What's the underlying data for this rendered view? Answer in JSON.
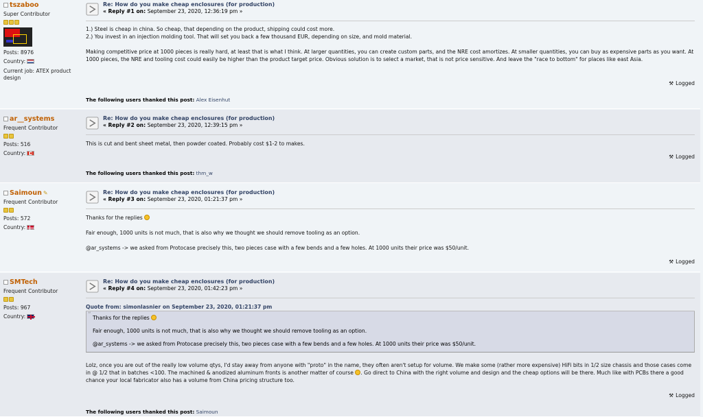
{
  "posts": [
    {
      "username": "tszaboo",
      "rank": "Super Contributor",
      "posts_label": "Posts: 8976",
      "country_label": "Country:",
      "job": "Current job: ATEX product design",
      "title": "Re: How do you make cheap enclosures (for production)",
      "reply_label": "« Reply #1 on:",
      "date": "September 23, 2020, 12:36:19 pm »",
      "body": [
        "1.) Steel is cheap in china. So cheap, that depending on the product, shipping could cost more.",
        "2.) You invest in an injection molding tool. That will set you back a few thousand EUR, depending on size, and mold material.",
        "Making competitive price at 1000 pieces is really hard, at least that is what I think. At larger quantities, you can create custom parts, and the NRE cost amortizes. At smaller quantities, you can buy as expensive parts as you want. At 1000 pieces, the NRE and tooling cost could easily be higher than the product target price. Obvious solution is to select a market, that is not price sensitive. And leave the \"race to bottom\" for places like east Asia."
      ],
      "logged": "Logged",
      "thanks_label": "The following users thanked this post:",
      "thanks_user": "Alex Eisenhut"
    },
    {
      "username": "ar__systems",
      "rank": "Frequent Contributor",
      "posts_label": "Posts: 516",
      "country_label": "Country:",
      "title": "Re: How do you make cheap enclosures (for production)",
      "reply_label": "« Reply #2 on:",
      "date": "September 23, 2020, 12:39:15 pm »",
      "body": [
        "This is cut and bent sheet metal, then powder coated. Probably cost $1-2 to makes."
      ],
      "logged": "Logged",
      "thanks_label": "The following users thanked this post:",
      "thanks_user": "thm_w"
    },
    {
      "username": "Saimoun",
      "rank": "Frequent Contributor",
      "posts_label": "Posts: 572",
      "country_label": "Country:",
      "title": "Re: How do you make cheap enclosures (for production)",
      "reply_label": "« Reply #3 on:",
      "date": "September 23, 2020, 01:21:37 pm »",
      "body": [
        "Thanks for the replies",
        "Fair enough, 1000 units is not much, that is also why we thought we should remove tooling as an option.",
        "@ar_systems -> we asked from Protocase precisely this, two pieces case with a few bends and a few holes. At 1000 units their price was $50/unit."
      ],
      "logged": "Logged"
    },
    {
      "username": "SMTech",
      "rank": "Frequent Contributor",
      "posts_label": "Posts: 967",
      "country_label": "Country:",
      "title": "Re: How do you make cheap enclosures (for production)",
      "reply_label": "« Reply #4 on:",
      "date": "September 23, 2020, 01:42:23 pm »",
      "quote_header": "Quote from: simonlasnier on September 23, 2020, 01:21:37 pm",
      "quote": [
        "Thanks for the replies",
        "Fair enough, 1000 units is not much, that is also why we thought we should remove tooling as an option.",
        "@ar_systems -> we asked from Protocase precisely this, two pieces case with a few bends and a few holes. At 1000 units their price was $50/unit."
      ],
      "body_a": "Lolz, once you are out of the really low volume qtys, I'd stay away from anyone with \"proto\" in the name, they often aren't setup for volume. We make some (rather more expensive) HiFi bits in 1/2 size chassis and those cases come in @ 1/2 that in batches <100. The machined & anodized aluminum fronts is another matter of course",
      "body_b": ". Go direct to China with the right volume and design and the cheap options will be there. Much like with PCBs there a good chance your local fabricator also has a volume from China pricing structure too.",
      "logged": "Logged",
      "thanks_label": "The following users thanked this post:",
      "thanks_user": "Saimoun"
    }
  ],
  "colors": {
    "username": "#c06002",
    "title": "#334466",
    "post_bg_a": "#f0f4f7",
    "post_bg_b": "#e7eaef"
  },
  "icons": {
    "post": "xx-post-icon",
    "logged": "user-logged-icon",
    "smiley": "smiley-icon",
    "flags": [
      "netherlands-flag-icon",
      "canada-flag-icon",
      "denmark-flag-icon",
      "uk-flag-icon"
    ]
  }
}
